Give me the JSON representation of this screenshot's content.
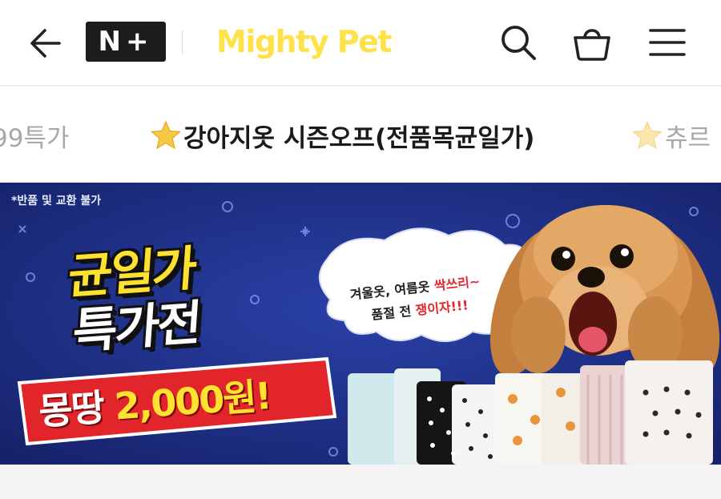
{
  "header": {
    "back_icon": "arrow-left-icon",
    "badge_text": "N+",
    "brand_name": "Mighty Pet",
    "brand_color": "#ffe14a",
    "search_icon": "search-icon",
    "cart_icon": "shopping-basket-icon",
    "menu_icon": "hamburger-menu-icon"
  },
  "category_strip": {
    "items": [
      {
        "label": "99특가",
        "active": false
      },
      {
        "label": "강아지옷 시즌오프(전품목균일가)",
        "active": true
      },
      {
        "label": "츄르",
        "active": false
      }
    ]
  },
  "banner": {
    "notice": "*반품 및 교환 불가",
    "title_line1": "균일가",
    "title_line2": "특가전",
    "price_prefix": "몽땅",
    "price_amount": "2,000원!",
    "bubble_line1_a": "겨울옷, 여름옷 ",
    "bubble_line1_b": "싹쓰리~",
    "bubble_line2_a": "품절 전 ",
    "bubble_line2_b": "쟁이자!!!",
    "background_color": "#1c2f86",
    "accent_yellow": "#ffe22f",
    "accent_red": "#e2262c"
  }
}
